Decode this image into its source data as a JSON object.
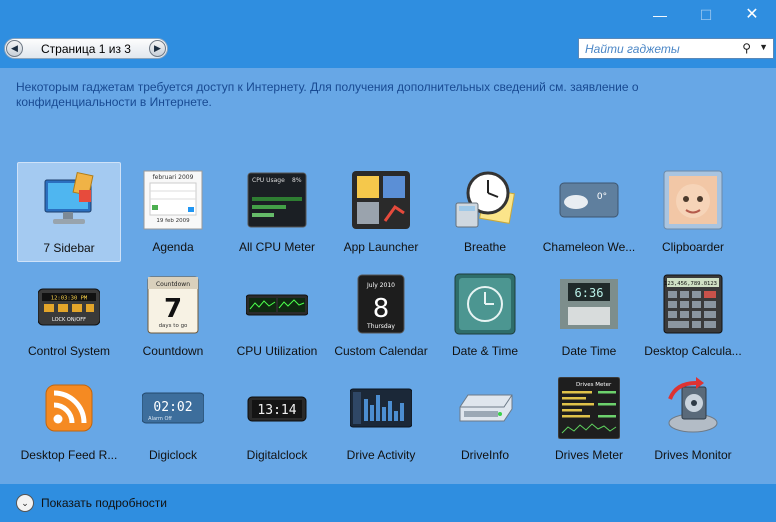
{
  "window": {
    "min": "—",
    "max": "☐",
    "close": "✕"
  },
  "pager": {
    "prev": "◀",
    "next": "▶",
    "label": "Страница 1 из 3"
  },
  "search": {
    "placeholder": "Найти гаджеты",
    "icon": "⚲",
    "dropdown": "▼"
  },
  "notice": "Некоторым гаджетам требуется доступ к Интернету. Для получения дополнительных сведений см. заявление о конфиденциальности в Интернете.",
  "gadgets": [
    {
      "label": "7 Sidebar",
      "icon": "monitor-icon"
    },
    {
      "label": "Agenda",
      "icon": "calendar-icon"
    },
    {
      "label": "All CPU Meter",
      "icon": "cpu-meter-icon"
    },
    {
      "label": "App Launcher",
      "icon": "app-launcher-icon"
    },
    {
      "label": "Breathe",
      "icon": "clock-calculator-icon"
    },
    {
      "label": "Chameleon We...",
      "icon": "weather-icon"
    },
    {
      "label": "Clipboarder",
      "icon": "baby-photo-icon"
    },
    {
      "label": "Control System",
      "icon": "control-panel-icon"
    },
    {
      "label": "Countdown",
      "icon": "countdown-calendar-icon"
    },
    {
      "label": "CPU Utilization",
      "icon": "cpu-graph-icon"
    },
    {
      "label": "Custom Calendar",
      "icon": "custom-calendar-icon"
    },
    {
      "label": "Date & Time",
      "icon": "teal-clock-icon"
    },
    {
      "label": "Date Time",
      "icon": "digital-clock-icon"
    },
    {
      "label": "Desktop Calcula...",
      "icon": "calculator-icon"
    },
    {
      "label": "Desktop Feed R...",
      "icon": "rss-icon"
    },
    {
      "label": "Digiclock",
      "icon": "digiclock-icon"
    },
    {
      "label": "Digitalclock",
      "icon": "lcd-clock-icon"
    },
    {
      "label": "Drive Activity",
      "icon": "drive-activity-icon"
    },
    {
      "label": "DriveInfo",
      "icon": "hard-drive-icon"
    },
    {
      "label": "Drives Meter",
      "icon": "drives-meter-icon"
    },
    {
      "label": "Drives Monitor",
      "icon": "drives-monitor-icon"
    }
  ],
  "icon_text": {
    "agenda_month": "februari 2009",
    "agenda_date": "19 feb 2009",
    "cpu_title": "CPU Usage",
    "cpu_pct": "8%",
    "weather_temp": "0°",
    "control_time": "12:03:30 PM",
    "control_lock": "LOCK ON/OFF",
    "countdown_title": "Countdown",
    "countdown_num": "7",
    "countdown_sub": "days to go",
    "cal_month": "July 2010",
    "cal_day": "8",
    "cal_weekday": "Thursday",
    "datetime_time": "6:36",
    "calc_display": "123,456,789.0123",
    "digiclock_time": "02:02",
    "digiclock_sub": "Alarm Off",
    "lcd_time": "13:14",
    "drives_meter_title": "Drives Meter"
  },
  "footer": {
    "toggle": "⌄",
    "label": "Показать подробности"
  },
  "colors": {
    "titlebar": "#2f8ee0",
    "body": "#67a7e6",
    "notice_text": "#184a92"
  }
}
